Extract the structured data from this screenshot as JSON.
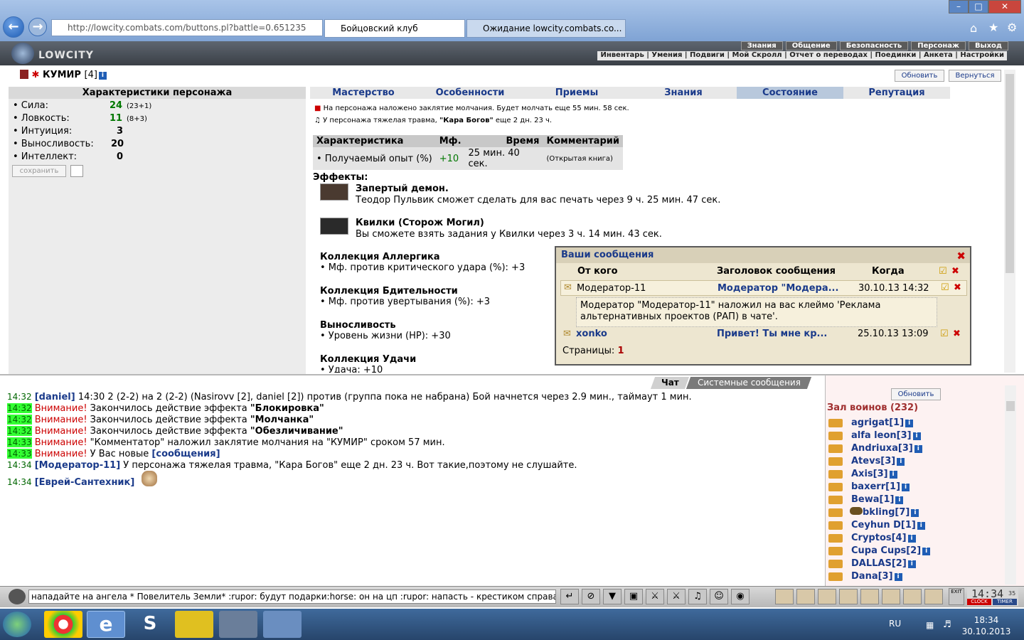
{
  "browser": {
    "address": "http://lowcity.combats.com/buttons.pl?battle=0.651235",
    "tab1": "Бойцовский клуб",
    "tab2": "Ожидание lowcity.combats.co..."
  },
  "game": {
    "logo": "LOWCITY",
    "menu_top": [
      "Знания",
      "Общение",
      "Безопасность",
      "Персонаж",
      "Выход"
    ],
    "menu_bottom": "Инвентарь | Умения | Подвиги | Мой Скролл | Отчет о переводах | Поединки | Анкета | Настройки"
  },
  "char": {
    "name": "КУМИР",
    "level": "[4]",
    "stats_title": "Характеристики персонажа",
    "stats": [
      {
        "label": "• Сила:",
        "value": "24",
        "extra": "(23+1)"
      },
      {
        "label": "• Ловкость:",
        "value": "11",
        "extra": "(8+3)"
      },
      {
        "label": "• Интуиция:",
        "value": "3",
        "extra": ""
      },
      {
        "label": "• Выносливость:",
        "value": "20",
        "extra": ""
      },
      {
        "label": "• Интеллект:",
        "value": "0",
        "extra": ""
      }
    ],
    "save_btn": "сохранить"
  },
  "buttons": {
    "refresh": "Обновить",
    "back": "Вернуться"
  },
  "tabs": [
    "Мастерство",
    "Особенности",
    "Приемы",
    "Знания",
    "Состояние",
    "Репутация"
  ],
  "status": {
    "line1": "На персонажа наложено заклятие молчания. Будет молчать еще 55 мин. 58 сек.",
    "line2_pre": "У персонажа тяжелая травма, ",
    "line2_bold": "\"Кара Богов\"",
    "line2_post": " еще 2 дн. 23 ч."
  },
  "table": {
    "headers": [
      "Характеристика",
      "Мф.",
      "Время",
      "Комментарий"
    ],
    "row": [
      "• Получаемый опыт (%)",
      "+10",
      "25 мин. 40 сек.",
      "(Открытая книга)"
    ]
  },
  "effects": {
    "title": "Эффекты:",
    "items": [
      {
        "name": "Запертый демон.",
        "desc": "Теодор Пульвик сможет сделать для вас печать через 9 ч. 25 мин. 47 сек."
      },
      {
        "name": "Квилки (Сторож Могил)",
        "desc": "Вы сможете взять задания у Квилки через 3 ч. 14 мин. 43 сек."
      }
    ],
    "collections": [
      {
        "name": "Коллекция Аллергика",
        "desc": "• Мф. против критического удара (%): +3"
      },
      {
        "name": "Коллекция Бдительности",
        "desc": "• Мф. против увертывания (%): +3"
      },
      {
        "name": "Выносливость",
        "desc": "• Уровень жизни (HP): +30"
      },
      {
        "name": "Коллекция Удачи",
        "desc": "• Удача: +10"
      }
    ]
  },
  "messages": {
    "title": "Ваши сообщения",
    "headers": [
      "От кого",
      "Заголовок сообщения",
      "Когда"
    ],
    "rows": [
      {
        "from": "Модератор-11",
        "subject": "Модератор \"Модера...",
        "when": "30.10.13 14:32",
        "body": "Модератор \"Модератор-11\" наложил на вас клеймо 'Реклама альтернативных проектов (РАП) в чате'."
      },
      {
        "from": "xonko",
        "subject": "Привет! Ты мне кр...",
        "when": "25.10.13 13:09"
      }
    ],
    "pages_label": "Страницы:",
    "page": "1"
  },
  "chat": {
    "tabs": [
      "Чат",
      "Системные сообщения"
    ],
    "lines": [
      {
        "time": "14:32",
        "nick": "[daniel]",
        "text": " 14:30 2 (2-2) на 2 (2-2) (Nasirovv [2], daniel [2]) против (группа пока не набрана) Бой начнется через 2.9 мин., таймаут 1 мин."
      },
      {
        "time": "14:32",
        "warn": "Внимание!",
        "pre": " Закончилось действие эффекта ",
        "bold": "\"Блокировка\""
      },
      {
        "time": "14:32",
        "warn": "Внимание!",
        "pre": " Закончилось действие эффекта ",
        "bold": "\"Молчанка\""
      },
      {
        "time": "14:32",
        "warn": "Внимание!",
        "pre": " Закончилось действие эффекта ",
        "bold": "\"Обезличивание\""
      },
      {
        "time": "14:33",
        "warn": "Внимание!",
        "pre": " \"Комментатор\" наложил заклятие молчания на \"КУМИР\" сроком 57 мин.",
        "bold": ""
      },
      {
        "time": "14:33",
        "warn": "Внимание!",
        "pre": " У Вас новые ",
        "link": "[сообщения]"
      },
      {
        "time": "14:34",
        "nick": "[Модератор-11]",
        "text": " У персонажа тяжелая травма, \"Кара Богов\" еще 2 дн. 23 ч. Вот такие,поэтому не слушайте."
      },
      {
        "time": "14:34",
        "nick": "[Еврей-Сантехник]",
        "text": ""
      }
    ]
  },
  "hall": {
    "refresh": "Обновить",
    "title": "Зал воинов (232)",
    "players": [
      "agrigat[1]",
      "alfa leon[3]",
      "Andriuxa[3]",
      "Atevs[3]",
      "Axis[3]",
      "baxerr[1]",
      "Bewa[1]",
      "bkling[7]",
      "Ceyhun D[1]",
      "Cryptos[4]",
      "Cupa Cups[2]",
      "DALLAS[2]",
      "Dana[3]"
    ]
  },
  "input": {
    "text": "нападайте на ангела  * Повелитель Земли* :rupor: будут подарки:horse: он на цп :rupor: напасть - крестиком справа от ника !"
  },
  "clock": {
    "game": "14:34",
    "sec": "35",
    "clock_label": "CLOCK",
    "timer_label": "TIMER"
  },
  "taskbar": {
    "lang": "RU",
    "time": "18:34",
    "date": "30.10.2013"
  }
}
